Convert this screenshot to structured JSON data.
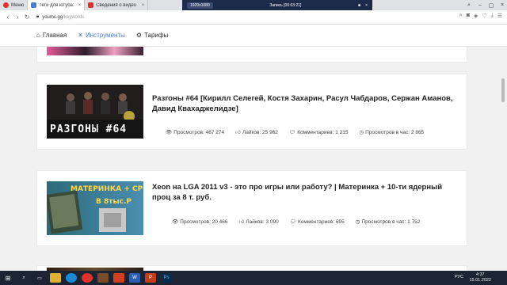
{
  "browser": {
    "tabs": [
      {
        "label": "Меню",
        "color": "#e0312b"
      },
      {
        "label": "Теги для ютуба: онлайн г...",
        "color": "#4a7dd4"
      },
      {
        "label": "Сведения о видео - YouT...",
        "color": "#e0312b"
      }
    ],
    "recorder": {
      "resolution": "1920x1080",
      "status": "Запись [00:03:21]"
    },
    "url_host": "youmc.gg",
    "url_path": "/keywords"
  },
  "site_nav": {
    "home": "Главная",
    "tools": "Инструменты",
    "pricing": "Тарифы"
  },
  "videos": [
    {
      "title": "Разгоны #64 [Кирилл Селегей, Костя Захарин, Расул Чабдаров, Сержан Аманов, Давид Квахаджелидзе]",
      "thumb_text": "РАЗГОНЫ #64",
      "views": "Просмотров: 467 274",
      "likes": "Лайков: 25 962",
      "comments": "Комментариев: 1 215",
      "per_hour": "Просмотров в час: 2 865"
    },
    {
      "title": "Xeon на LGA 2011 v3 - это про игры или работу? | Материнка + 10-ти ядерный проц за 8 т. руб.",
      "thumb_text": "МАТЕРИНКА + CPU",
      "thumb_sub": "В 8тыс.Р",
      "views": "Просмотров: 20 466",
      "likes": "Лайков: 3 090",
      "comments": "Комментариев: 695",
      "per_hour": "Просмотров в час: 1 752"
    }
  ],
  "taskbar": {
    "lang": "РУС",
    "time": "4:37",
    "date": "15.01.2022"
  }
}
